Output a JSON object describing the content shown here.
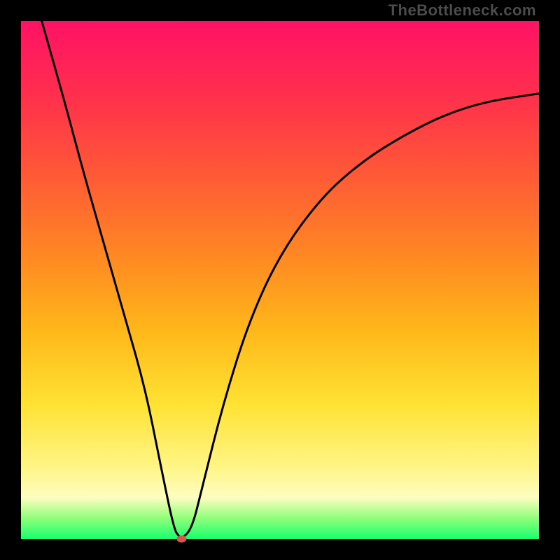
{
  "watermark": "TheBottleneck.com",
  "chart_data": {
    "type": "line",
    "title": "",
    "xlabel": "",
    "ylabel": "",
    "xlim": [
      0,
      100
    ],
    "ylim": [
      0,
      100
    ],
    "legend": false,
    "grid": false,
    "background_gradient": {
      "direction": "vertical",
      "stops": [
        {
          "pos": 0,
          "color": "#ff1266"
        },
        {
          "pos": 14,
          "color": "#ff2e4d"
        },
        {
          "pos": 30,
          "color": "#ff5a36"
        },
        {
          "pos": 46,
          "color": "#ff8a22"
        },
        {
          "pos": 60,
          "color": "#ffb81a"
        },
        {
          "pos": 74,
          "color": "#ffe233"
        },
        {
          "pos": 86,
          "color": "#fff585"
        },
        {
          "pos": 92,
          "color": "#fdfdc0"
        },
        {
          "pos": 96,
          "color": "#8fff7a"
        },
        {
          "pos": 100,
          "color": "#18ff6e"
        }
      ]
    },
    "series": [
      {
        "name": "bottleneck-curve",
        "color": "#000000",
        "x": [
          4,
          8,
          12,
          16,
          20,
          24,
          27,
          29.5,
          30.5,
          31,
          33,
          35,
          39,
          44,
          50,
          58,
          66,
          74,
          82,
          90,
          100
        ],
        "y": [
          100,
          86,
          71,
          57,
          43,
          29,
          14,
          2,
          0.5,
          0,
          2,
          10,
          26,
          42,
          55,
          66,
          73,
          78,
          82,
          84.5,
          86
        ]
      }
    ],
    "marker": {
      "name": "min-point",
      "x": 31,
      "y": 0,
      "color": "#d9554d",
      "rx": 7,
      "ry": 5
    }
  }
}
